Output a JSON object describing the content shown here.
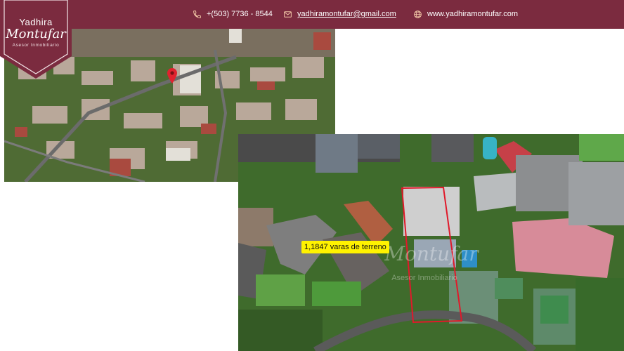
{
  "brand": {
    "name_line1": "Yadhira",
    "name_line2": "Montufar",
    "tagline": "Asesor Inmobiliario"
  },
  "contact": {
    "phone": "+(503) 7736 - 8544",
    "email": "yadhiramontufar@gmail.com",
    "website": "www.yadhiramontufar.com"
  },
  "lot_label": "1,1847 varas de terreno",
  "watermark": {
    "line1": "Montufar",
    "line2": "Asesor Inmobiliario"
  },
  "icons": {
    "phone": "phone-icon",
    "email": "mail-icon",
    "website": "globe-icon",
    "pin": "map-pin-icon"
  },
  "colors": {
    "brand": "#7b2b3f",
    "label_bg": "#fff200",
    "outline": "#e0192a"
  }
}
